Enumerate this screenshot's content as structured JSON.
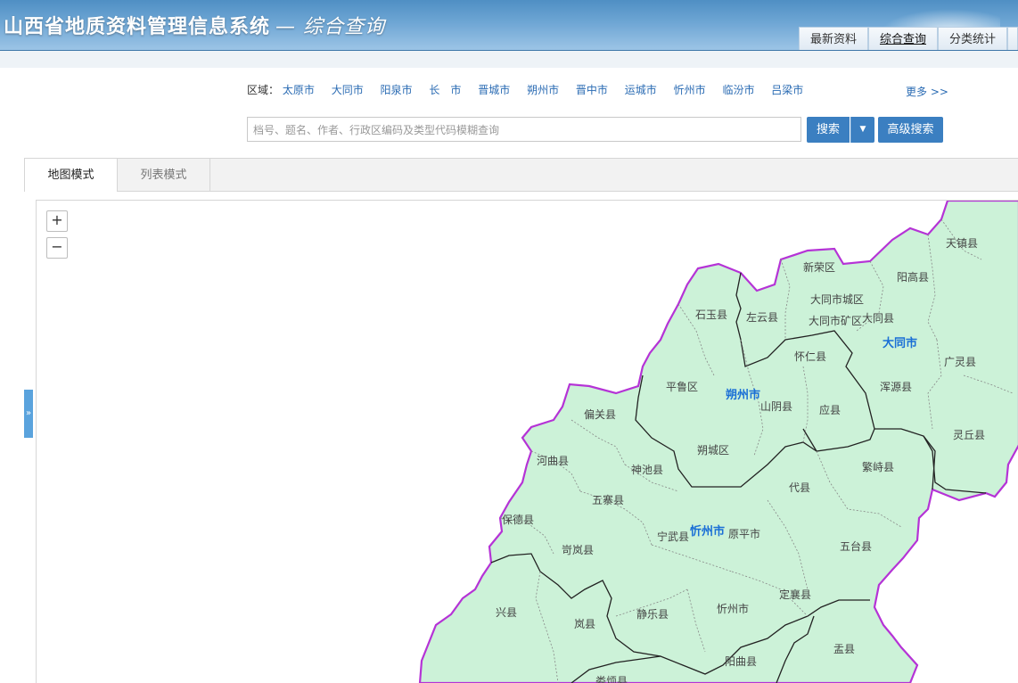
{
  "header": {
    "title": "山西省地质资料管理信息系统",
    "subtitle": "— 综合查询",
    "nav": [
      {
        "label": "最新资料",
        "active": false
      },
      {
        "label": "综合查询",
        "active": true
      },
      {
        "label": "分类统计",
        "active": false
      }
    ]
  },
  "search": {
    "region_label": "区域：",
    "regions": [
      "太原市",
      "大同市",
      "阳泉市",
      "长　市",
      "晋城市",
      "朔州市",
      "晋中市",
      "运城市",
      "忻州市",
      "临汾市",
      "吕梁市"
    ],
    "more_label": "更多 >>",
    "placeholder": "档号、题名、作者、行政区编码及类型代码模糊查询",
    "search_button": "搜索",
    "advanced_button": "高级搜索"
  },
  "tabs": [
    {
      "label": "地图模式",
      "active": true
    },
    {
      "label": "列表模式",
      "active": false
    }
  ],
  "map": {
    "zoom_in": "+",
    "zoom_out": "−",
    "side_toggle": "»",
    "fill_color": "#ccf2d8",
    "province_border_color": "#b533d6",
    "cities": [
      "大同市",
      "朔州市",
      "忻州市"
    ],
    "counties": [
      "天镇县",
      "新荣区",
      "阳高县",
      "大同市城区",
      "石玉县",
      "左云县",
      "大同市矿区",
      "大同县",
      "怀仁县",
      "广灵县",
      "平鲁区",
      "山阴县",
      "应县",
      "浑源县",
      "偏关县",
      "朔城区",
      "灵丘县",
      "河曲县",
      "神池县",
      "繁峙县",
      "代县",
      "五寨县",
      "保德县",
      "宁武县",
      "原平市",
      "五台县",
      "岢岚县",
      "定襄县",
      "兴县",
      "岚县",
      "静乐县",
      "忻州市",
      "盂县",
      "阳曲县",
      "娄烦县"
    ]
  }
}
